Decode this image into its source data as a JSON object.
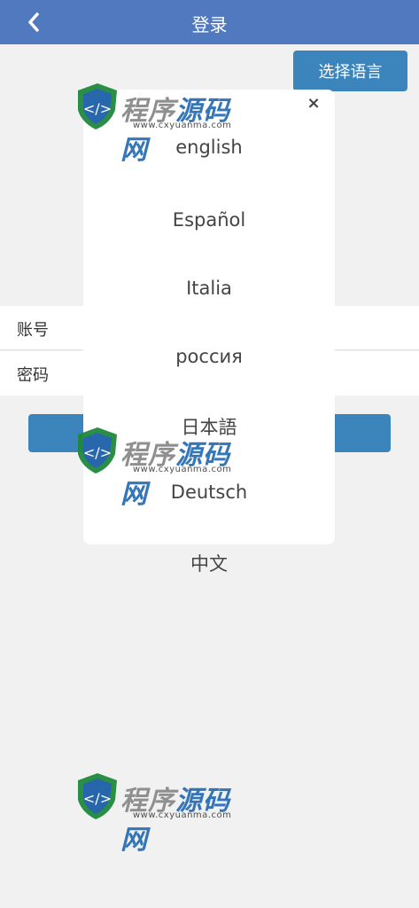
{
  "header": {
    "title": "登录"
  },
  "language_button": {
    "label": "选择语言"
  },
  "form": {
    "account_label": "账号",
    "password_label": "密码"
  },
  "popup": {
    "close_glyph": "×",
    "languages": [
      "english",
      "Español",
      "Italia",
      "россия",
      "日本語",
      "Deutsch",
      "中文"
    ]
  },
  "watermark": {
    "brand_a": "程序",
    "brand_b": "源码网",
    "url": "www.cxyuanma.com"
  },
  "colors": {
    "header": "#5179bf",
    "button": "#3b84bc",
    "background": "#f1f1f1"
  }
}
